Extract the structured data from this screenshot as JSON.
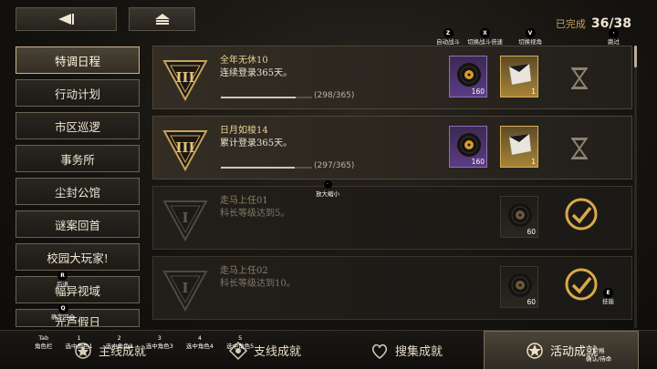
{
  "header": {
    "completed_label": "已完成",
    "completed_count": "36/38"
  },
  "key_hints": [
    {
      "key": "Z",
      "label": "自动战斗"
    },
    {
      "key": "X",
      "label": "切换战斗倍速"
    },
    {
      "key": "V",
      "label": "切换视角"
    },
    {
      "key": "·",
      "label": "跳过"
    }
  ],
  "sidebar": {
    "items": [
      {
        "label": "特调日程",
        "active": true
      },
      {
        "label": "行动计划"
      },
      {
        "label": "市区巡逻"
      },
      {
        "label": "事务所"
      },
      {
        "label": "尘封公馆"
      },
      {
        "label": "谜案回首"
      },
      {
        "label": "校园大玩家!"
      },
      {
        "label": "幅异视域"
      },
      {
        "label": "光芦假日"
      }
    ],
    "hint_r": {
      "key": "R",
      "label": "后退"
    },
    "hint_q": {
      "key": "Q",
      "label": "确定回合"
    }
  },
  "achievements": [
    {
      "title": "全年无休10",
      "desc": "连续登录365天。",
      "progress_text": "(298/365)",
      "progress": 0.816,
      "rank": "III",
      "rewards": [
        {
          "count": "160",
          "rarity": "purple",
          "icon": "record-icon"
        },
        {
          "count": "1",
          "rarity": "gold",
          "icon": "card-icon"
        }
      ],
      "state": "in-progress"
    },
    {
      "title": "日月如梭14",
      "desc": "累计登录365天。",
      "progress_text": "(297/365)",
      "progress": 0.814,
      "rank": "III",
      "rewards": [
        {
          "count": "160",
          "rarity": "purple",
          "icon": "record-icon"
        },
        {
          "count": "1",
          "rarity": "gold",
          "icon": "card-icon"
        }
      ],
      "state": "in-progress"
    },
    {
      "title": "走马上任01",
      "desc": "科长等级达到5。",
      "rank": "I",
      "rewards": [
        {
          "count": "60",
          "rarity": "dark",
          "icon": "record-icon"
        }
      ],
      "state": "done"
    },
    {
      "title": "走马上任02",
      "desc": "科长等级达到10。",
      "rank": "I",
      "rewards": [
        {
          "count": "60",
          "rarity": "dark",
          "icon": "record-icon"
        }
      ],
      "state": "done"
    }
  ],
  "zoom_hint": {
    "key": "·",
    "label": "放大缩小"
  },
  "skill_hint": {
    "key": "E",
    "label": "技能"
  },
  "bottom_tabs": [
    {
      "label": "主线成就"
    },
    {
      "label": "支线成就"
    },
    {
      "label": "搜集成就"
    },
    {
      "label": "活动成就",
      "active": true
    }
  ],
  "role_hints": [
    {
      "key": "Tab",
      "label": "角色栏"
    },
    {
      "key": "1",
      "label": "选中角色1"
    },
    {
      "key": "2",
      "label": "选中角色2"
    },
    {
      "key": "3",
      "label": "选中角色3"
    },
    {
      "key": "4",
      "label": "选中角色4"
    },
    {
      "key": "5",
      "label": "选中角色5"
    }
  ],
  "confirm_hint": {
    "key": "空格",
    "label": "确认/待命"
  },
  "colors": {
    "gold": "#c9a25a",
    "purple": "#5b3b84",
    "check": "#d9a94a"
  }
}
